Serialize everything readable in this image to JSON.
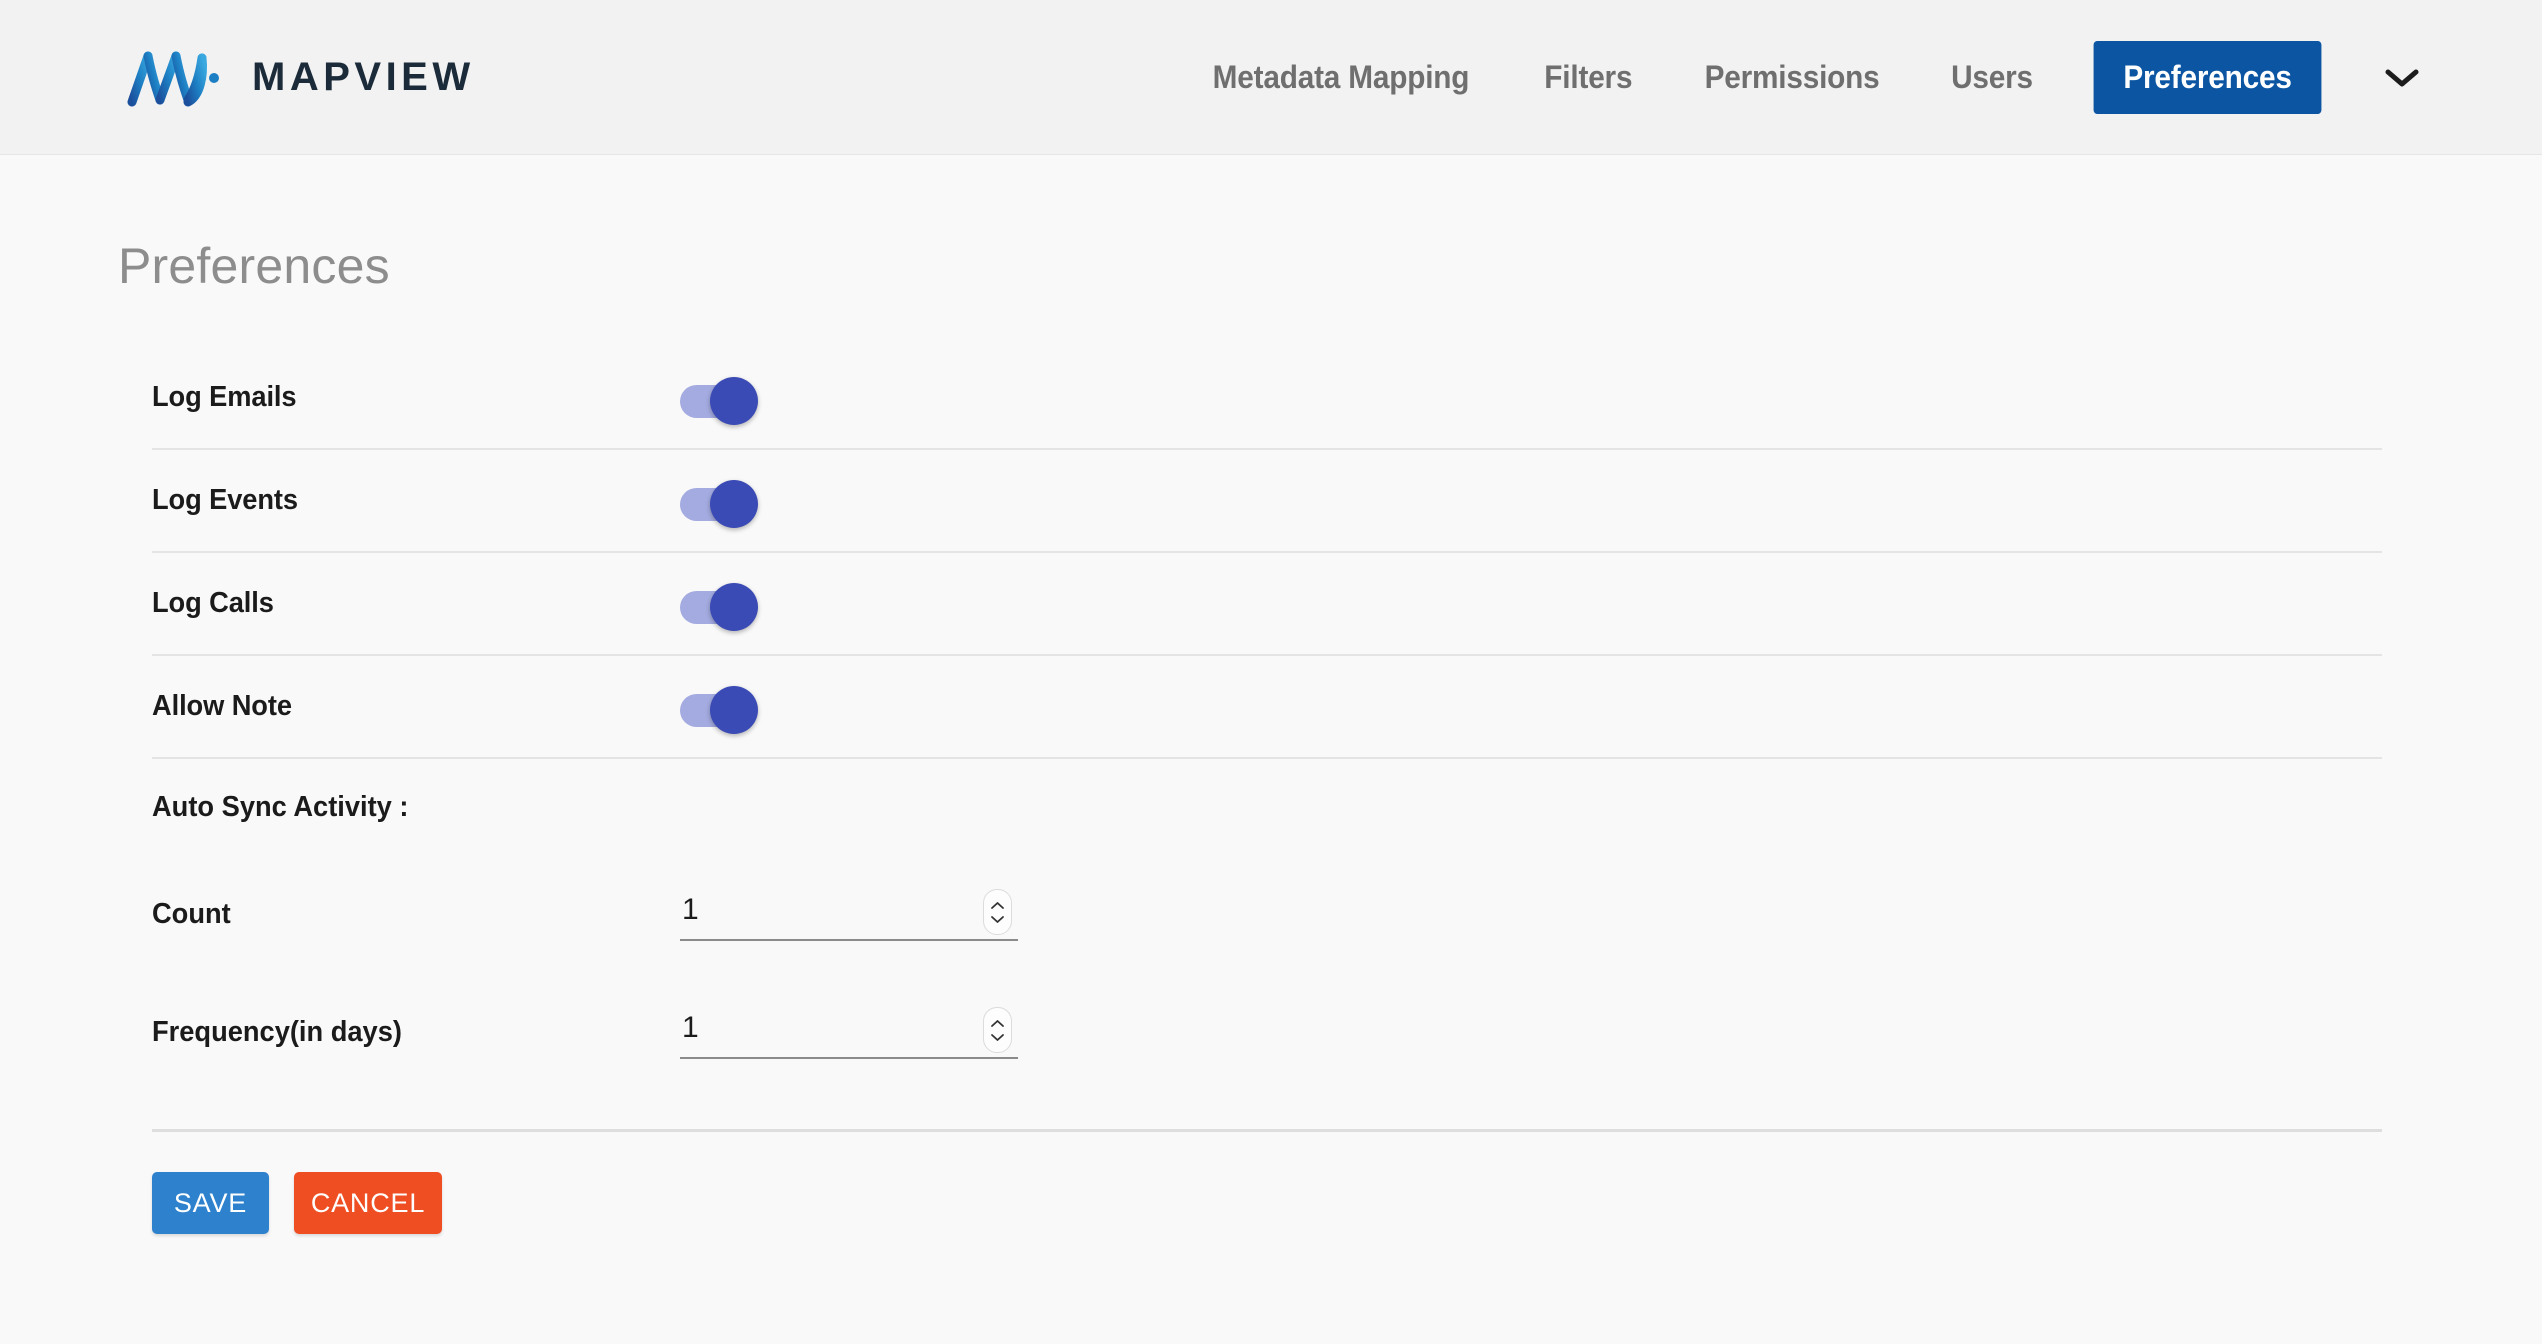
{
  "header": {
    "brand": {
      "mark_icon": "mapview-m-logo-icon",
      "wordmark": "MAPVIEW"
    },
    "nav": [
      {
        "label": "Metadata Mapping",
        "active": false
      },
      {
        "label": "Filters",
        "active": false
      },
      {
        "label": "Permissions",
        "active": false
      },
      {
        "label": "Users",
        "active": false
      },
      {
        "label": "Preferences",
        "active": true
      }
    ],
    "caret_icon": "chevron-down-icon",
    "colors": {
      "header_bg": "#f2f2f2",
      "nav_text": "#6f6f6f",
      "active_tab_bg": "#0b55a2",
      "active_tab_text": "#ffffff"
    }
  },
  "page": {
    "title": "Preferences",
    "background": "#f9f9f9",
    "title_color": "#8d8d8d"
  },
  "preferences": {
    "toggles": [
      {
        "label": "Log Emails",
        "state": "on"
      },
      {
        "label": "Log Events",
        "state": "on"
      },
      {
        "label": "Log Calls",
        "state": "on"
      },
      {
        "label": "Allow Note",
        "state": "on"
      }
    ],
    "toggle_colors": {
      "track_on": "#a3abe0",
      "thumb_on": "#3b4bb5"
    },
    "auto_sync": {
      "section_label": "Auto Sync Activity :",
      "fields": [
        {
          "label": "Count",
          "value": "1",
          "placeholder": ""
        },
        {
          "label": "Frequency(in days)",
          "value": "1",
          "placeholder": ""
        }
      ]
    }
  },
  "actions": {
    "save_label": "SAVE",
    "cancel_label": "CANCEL",
    "save_color": "#2e81cd",
    "cancel_color": "#ef4e23"
  }
}
